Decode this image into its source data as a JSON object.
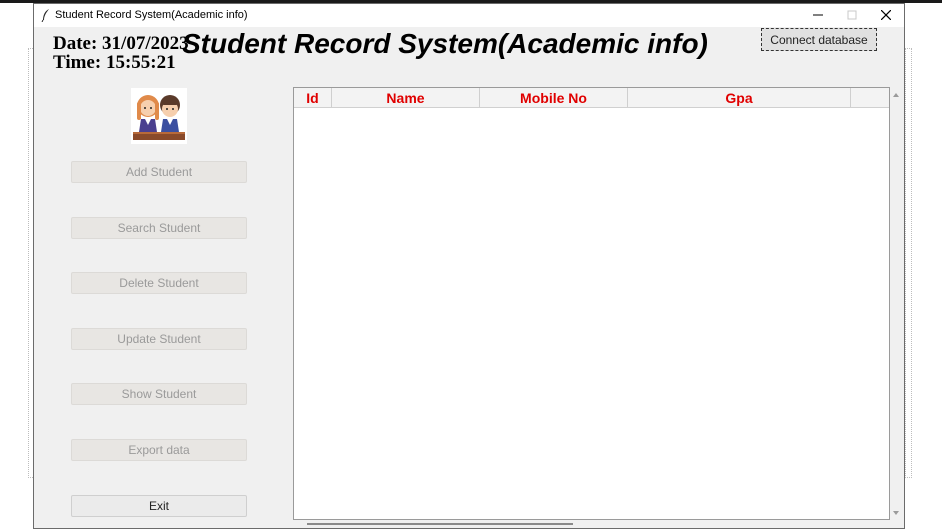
{
  "window": {
    "title": "Student Record System(Academic info)",
    "minimize_icon": "minimize-icon",
    "maximize_icon": "maximize-icon",
    "close_icon": "close-icon"
  },
  "header": {
    "date_text": "Date: 31/07/2023",
    "time_text": "Time: 15:55:21",
    "title": "Student Record System(Academic info)",
    "connect_label": "Connect database"
  },
  "sidebar": {
    "logo_icon": "students-logo-icon",
    "buttons": [
      {
        "label": "Add Student",
        "enabled": false
      },
      {
        "label": "Search Student",
        "enabled": false
      },
      {
        "label": "Delete Student",
        "enabled": false
      },
      {
        "label": "Update Student",
        "enabled": false
      },
      {
        "label": "Show Student",
        "enabled": false
      },
      {
        "label": "Export data",
        "enabled": false
      },
      {
        "label": "Exit",
        "enabled": true
      }
    ]
  },
  "table": {
    "columns": [
      "Id",
      "Name",
      "Mobile No",
      "Gpa"
    ],
    "header_color": "#e00000",
    "rows": []
  }
}
